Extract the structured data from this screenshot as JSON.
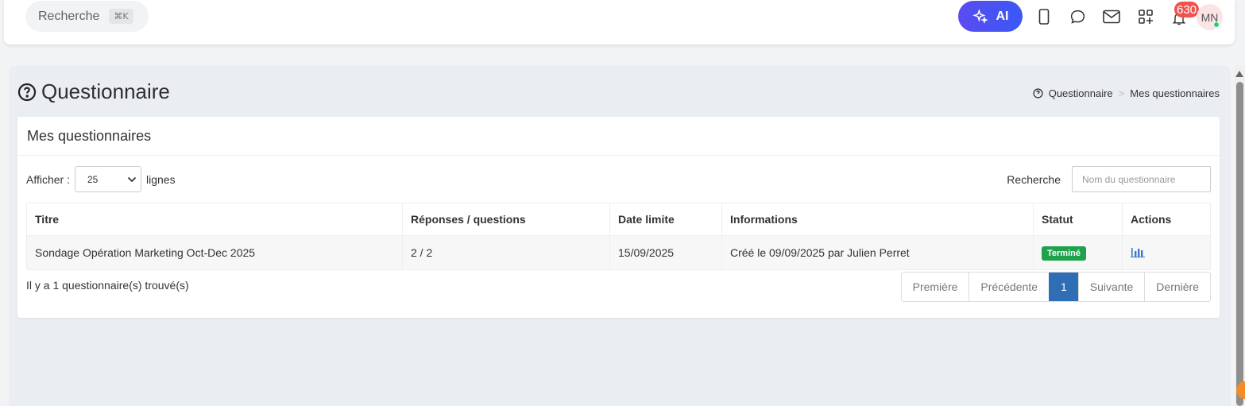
{
  "topbar": {
    "search_label": "Recherche",
    "search_shortcut": "⌘K",
    "ai_label": "AI",
    "notification_count": "630",
    "avatar_initials": "MN",
    "accent_color": "#4f55f2"
  },
  "page": {
    "title": "Questionnaire",
    "breadcrumb": [
      "Questionnaire",
      "Mes questionnaires"
    ]
  },
  "panel": {
    "title": "Mes questionnaires",
    "show_label": "Afficher :",
    "rows_per_page": "25",
    "rows_label": "lignes",
    "search_label": "Recherche",
    "search_placeholder": "Nom du questionnaire"
  },
  "table": {
    "headers": [
      "Titre",
      "Réponses / questions",
      "Date limite",
      "Informations",
      "Statut",
      "Actions"
    ],
    "rows": [
      {
        "title": "Sondage Opération Marketing Oct-Dec 2025",
        "responses": "2 / 2",
        "deadline": "15/09/2025",
        "info": "Créé le 09/09/2025 par Julien Perret",
        "status": "Terminé",
        "action_icon": "bar-chart-icon"
      }
    ]
  },
  "footer": {
    "count_text": "Il y a 1 questionnaire(s) trouvé(s)",
    "pagination": {
      "first": "Première",
      "prev": "Précédente",
      "current": "1",
      "next": "Suivante",
      "last": "Dernière"
    }
  }
}
